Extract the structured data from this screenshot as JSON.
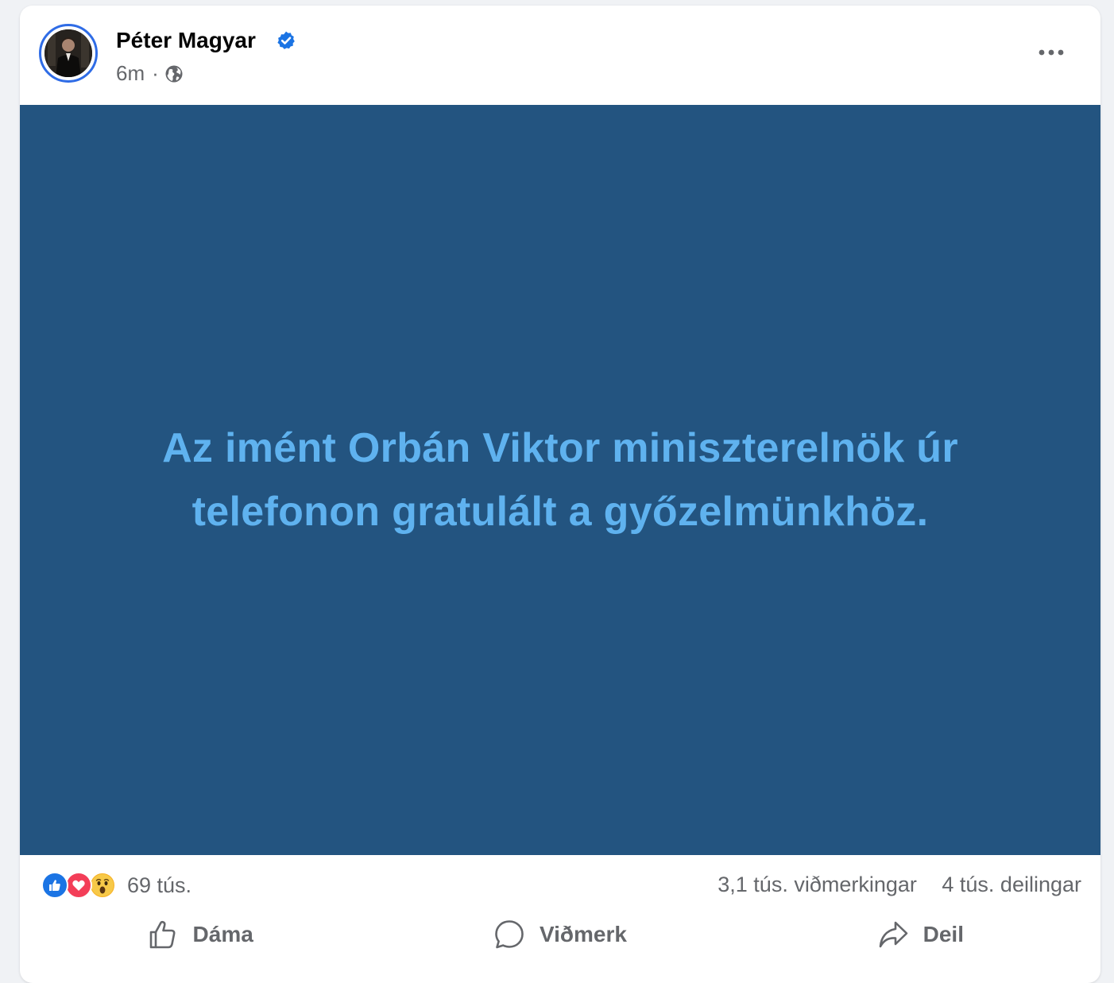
{
  "post": {
    "author": "Péter Magyar",
    "timestamp": "6m",
    "separator": "·",
    "visibility_icon": "globe-icon",
    "verified_icon": "verified-badge-icon",
    "more_icon": "more-options-icon",
    "text": "Az imént Orbán Viktor miniszterelnök úr telefonon gratulált a győzelmünkhöz.",
    "background_color": "#235480",
    "text_color": "#5fb2ef"
  },
  "stats": {
    "reaction_icons": [
      "like-reaction-icon",
      "love-reaction-icon",
      "wow-reaction-icon"
    ],
    "reactions_count": "69 tús.",
    "comments_count": "3,1 tús. viðmerkingar",
    "shares_count": "4 tús. deilingar"
  },
  "actions": {
    "like_label": "Dáma",
    "comment_label": "Viðmerk",
    "share_label": "Deil"
  },
  "colors": {
    "accent": "#2f6ce6",
    "like": "#1b74e4",
    "love": "#f33e58",
    "wow": "#f7b125",
    "secondary_text": "#65676b"
  }
}
